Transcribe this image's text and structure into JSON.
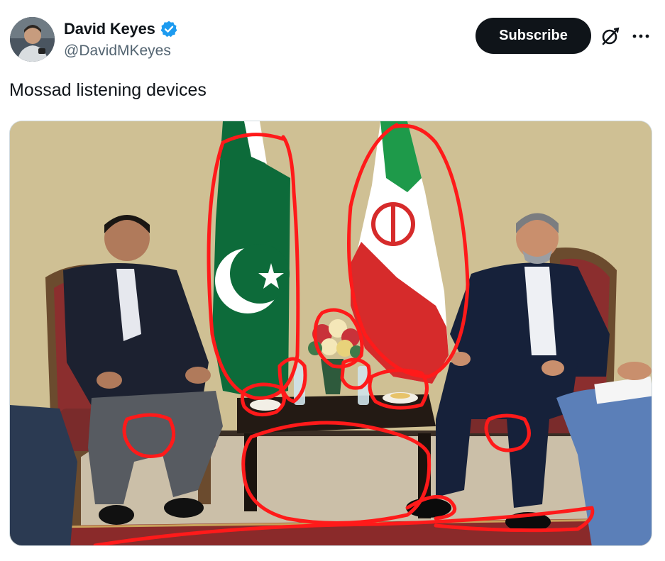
{
  "tweet": {
    "author": {
      "display_name": "David Keyes",
      "handle": "@DavidMKeyes",
      "verified": true,
      "avatar_icon": "avatar-photo"
    },
    "actions": {
      "subscribe_label": "Subscribe",
      "grok_icon": "grok-icon",
      "more_icon": "more-icon"
    },
    "text": "Mossad listening devices",
    "media": {
      "type": "photo",
      "description_icon": "meeting-photo-with-red-annotations"
    }
  },
  "colors": {
    "text_primary": "#0f1419",
    "text_secondary": "#536471",
    "verified_blue": "#1d9bf0",
    "subscribe_bg": "#0f1419",
    "annotation_red": "#ff1a1a"
  }
}
